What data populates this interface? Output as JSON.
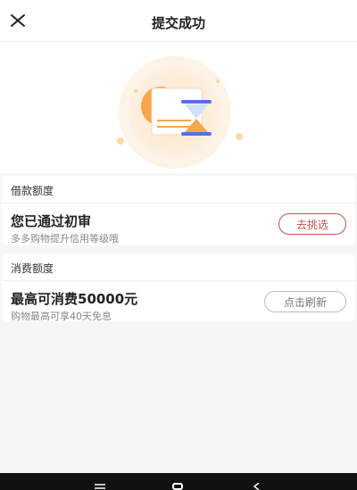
{
  "header": {
    "title": "提交成功"
  },
  "icons": {
    "close": "close-icon",
    "illustration": "document-hourglass-illustration",
    "menu": "menu-icon",
    "home": "home-icon",
    "back": "back-icon"
  },
  "loan_card": {
    "heading": "借款额度",
    "status": "您已通过初审",
    "hint": "多多购物提升信用等级哦",
    "button_label": "去挑选"
  },
  "spend_card": {
    "heading": "消费额度",
    "status": "最高可消费50000元",
    "hint": "购物最高可享40天免息",
    "button_label": "点击刷新"
  },
  "colors": {
    "accent": "#b8584c",
    "illustration_orange": "#f7a64a",
    "hourglass_blue": "#5b6ee6"
  }
}
